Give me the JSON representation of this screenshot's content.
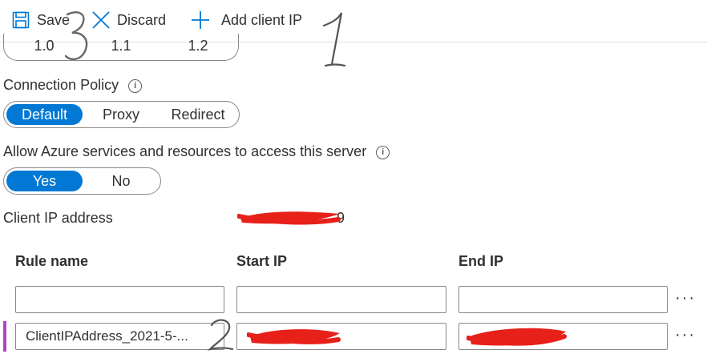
{
  "toolbar": {
    "save_label": "Save",
    "discard_label": "Discard",
    "add_client_ip_label": "Add client IP"
  },
  "tls_versions": {
    "options": [
      "1.0",
      "1.1",
      "1.2"
    ]
  },
  "connection_policy": {
    "label": "Connection Policy",
    "options": [
      "Default",
      "Proxy",
      "Redirect"
    ],
    "selected": "Default"
  },
  "azure_access": {
    "label": "Allow Azure services and resources to access this server",
    "options": [
      "Yes",
      "No"
    ],
    "selected": "Yes"
  },
  "client_ip": {
    "label": "Client IP address",
    "value_suffix": "9"
  },
  "firewall_table": {
    "headers": [
      "Rule name",
      "Start IP",
      "End IP"
    ],
    "rows": [
      {
        "rule_name": "",
        "start_ip": "",
        "end_ip": ""
      },
      {
        "rule_name": "ClientIPAddress_2021-5-...",
        "start_ip": "",
        "end_ip": ""
      }
    ],
    "more_label": "···"
  },
  "annotations": [
    "1",
    "2",
    "3"
  ],
  "colors": {
    "accent": "#0078d4",
    "redaction": "#e8201a",
    "row_marker": "#b146c2"
  },
  "icons": [
    "save-icon",
    "discard-icon",
    "add-icon",
    "info-icon",
    "more-icon"
  ]
}
